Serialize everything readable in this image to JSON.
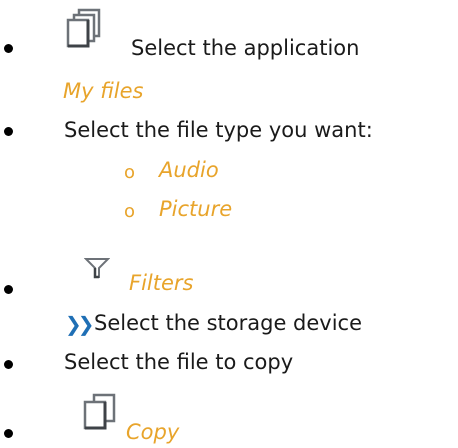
{
  "steps": [
    {
      "icon": "stacked-documents-icon",
      "text": "Select the application",
      "accent": "My files"
    },
    {
      "text": "Select the file type you want:",
      "options": [
        "Audio",
        "Picture"
      ],
      "option_marker": "o"
    },
    {
      "icon": "filter-icon",
      "accent": "Filters",
      "substep_marker": "❯❯",
      "substep_text": "Select the storage device"
    },
    {
      "text": "Select the file to copy"
    },
    {
      "icon": "copy-icon",
      "accent": "Copy"
    }
  ],
  "colors": {
    "accent": "#e8a42b",
    "chevron": "#1f6fb5",
    "text": "#1a1a1a"
  }
}
